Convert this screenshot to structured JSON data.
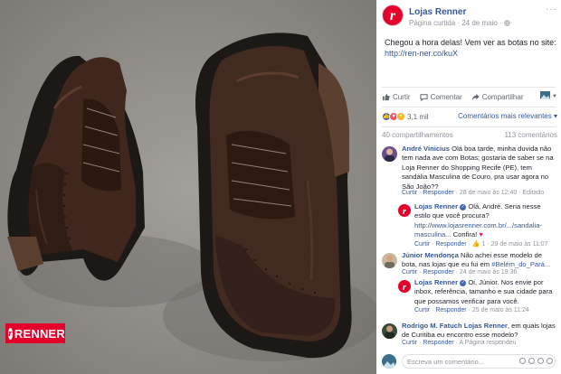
{
  "photo": {
    "brand_logo_text": "RENNER",
    "brand_logo_mark": "r",
    "colors": {
      "background": "#8f8c88",
      "leather": "#3b241b",
      "sole": "#1c1917",
      "suede": "#5a3f2e",
      "brand_red": "#e4002b"
    }
  },
  "post": {
    "page_name": "Lojas Renner",
    "meta": "Página curtida · 24 de maio · ",
    "more_icon": "ellipsis-icon",
    "text": "Chegou a hora delas! Vem ver as botas no site:",
    "link": "http://ren-ner.co/kuX"
  },
  "actions": {
    "like": "Curtir",
    "comment": "Comentar",
    "share": "Compartilhar"
  },
  "reactions": {
    "count": "3,1 mil",
    "sort_label": "Comentários mais relevantes ▾"
  },
  "stats": {
    "shares": "40 compartilhamentos",
    "comments": "113 comentários"
  },
  "comments": [
    {
      "author": "André Vinicius",
      "text": "Olá boa tarde, minha duvida não tem nada ave com Botas; gostaria de saber se na Loja Renner do Shopping Recife (PE), tem sandália Masculina de Couro, pra usar agora no São João??",
      "like": "Curtir",
      "reply": "Responder",
      "time": "28 de maio às 12:40",
      "edited": "Editado"
    },
    {
      "author": "Lojas Renner",
      "text": "Olá, André. Seria nesse estilo que você procura?",
      "link": "http://www.lojasrenner.com.br/.../sandalia-masculina...",
      "after": "Confira!",
      "like": "Curtir",
      "reply": "Responder",
      "likes": "1",
      "time": "29 de maio às 11:07"
    },
    {
      "author": "Júnior Mendonça",
      "text": "Não achei esse modelo de bota, nas lojas que eu fui em ",
      "link": "#Belém_do_Pará...",
      "like": "Curtir",
      "reply": "Responder",
      "time": "24 de maio às 19:36"
    },
    {
      "author": "Lojas Renner",
      "text": "Oi, Júnior. Nos envie por inbox, referência, tamanho e sua cidade para que possamos verificar para você.",
      "like": "Curtir",
      "reply": "Responder",
      "time": "25 de maio às 11:24"
    },
    {
      "author": "Rodrigo M. Fatuch",
      "author_tag": "Lojas Renner",
      "text": ", em quais lojas de Curitiba eu encontro esse modelo?",
      "like": "Curtir",
      "reply": "Responder",
      "time": "A Página respondeu"
    }
  ],
  "composer": {
    "placeholder": "Escreva um comentário..."
  }
}
